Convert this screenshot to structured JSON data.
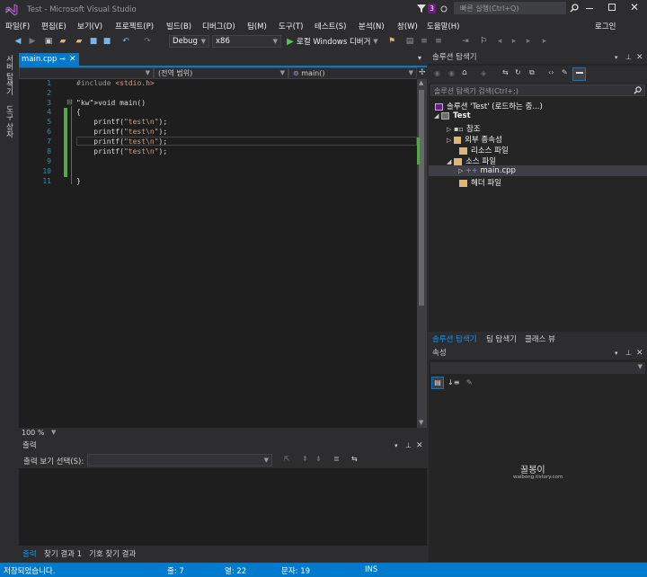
{
  "title": {
    "text": "Test - Microsoft Visual Studio",
    "notif_count": "3",
    "quick_launch_placeholder": "빠른 실행(Ctrl+Q)"
  },
  "menu": [
    "파일(F)",
    "편집(E)",
    "보기(V)",
    "프로젝트(P)",
    "빌드(B)",
    "디버그(D)",
    "팀(M)",
    "도구(T)",
    "테스트(S)",
    "분석(N)",
    "창(W)",
    "도움말(H)"
  ],
  "login": "로그인",
  "toolbar": {
    "config": "Debug",
    "platform": "x86",
    "run_label": "로컬 Windows 디버거"
  },
  "side_tabs": [
    "서버 탐색기",
    "도구 상자"
  ],
  "editor": {
    "tab": "main.cpp",
    "nav_scope": "(전역 범위)",
    "nav_member": "main()",
    "zoom": "100 %",
    "lines": [
      {
        "num": "1",
        "text": "#include <stdio.h>"
      },
      {
        "num": "2",
        "text": ""
      },
      {
        "num": "3",
        "text": "void main()"
      },
      {
        "num": "4",
        "text": "{"
      },
      {
        "num": "5",
        "text": "    printf(\"test\\n\");"
      },
      {
        "num": "6",
        "text": "    printf(\"test\\n\");"
      },
      {
        "num": "7",
        "text": "    printf(\"test\\n\");"
      },
      {
        "num": "8",
        "text": "    printf(\"test\\n\");"
      },
      {
        "num": "9",
        "text": ""
      },
      {
        "num": "10",
        "text": ""
      },
      {
        "num": "11",
        "text": "}"
      }
    ]
  },
  "output": {
    "title": "출력",
    "source_label": "출력 보기 선택(S):",
    "tabs": [
      "출력",
      "찾기 결과 1",
      "기호 찾기 결과"
    ]
  },
  "solution": {
    "title": "솔루션 탐색기",
    "search_placeholder": "솔루션 탐색기 검색(Ctrl+;)",
    "items": [
      {
        "label": "솔루션 'Test' (로드하는 중...)"
      },
      {
        "label": "Test"
      },
      {
        "label": "참조"
      },
      {
        "label": "외부 종속성"
      },
      {
        "label": "리소스 파일"
      },
      {
        "label": "소스 파일"
      },
      {
        "label": "main.cpp"
      },
      {
        "label": "헤더 파일"
      }
    ],
    "tabs": [
      "솔루션 탐색기",
      "팀 탐색기",
      "클래스 뷰"
    ]
  },
  "properties": {
    "title": "속성"
  },
  "watermark": {
    "line1": "꿀봉이",
    "line2": "waibong.tistory.com"
  },
  "status": {
    "message": "저장되었습니다.",
    "line": "줄: 7",
    "col": "열: 22",
    "char": "문자: 19",
    "mode": "INS"
  },
  "colors": {
    "accent": "#007acc",
    "keyword": "#569cd6",
    "string": "#d69d85",
    "line_number": "#2b91af",
    "change_bar": "#57a64a"
  }
}
